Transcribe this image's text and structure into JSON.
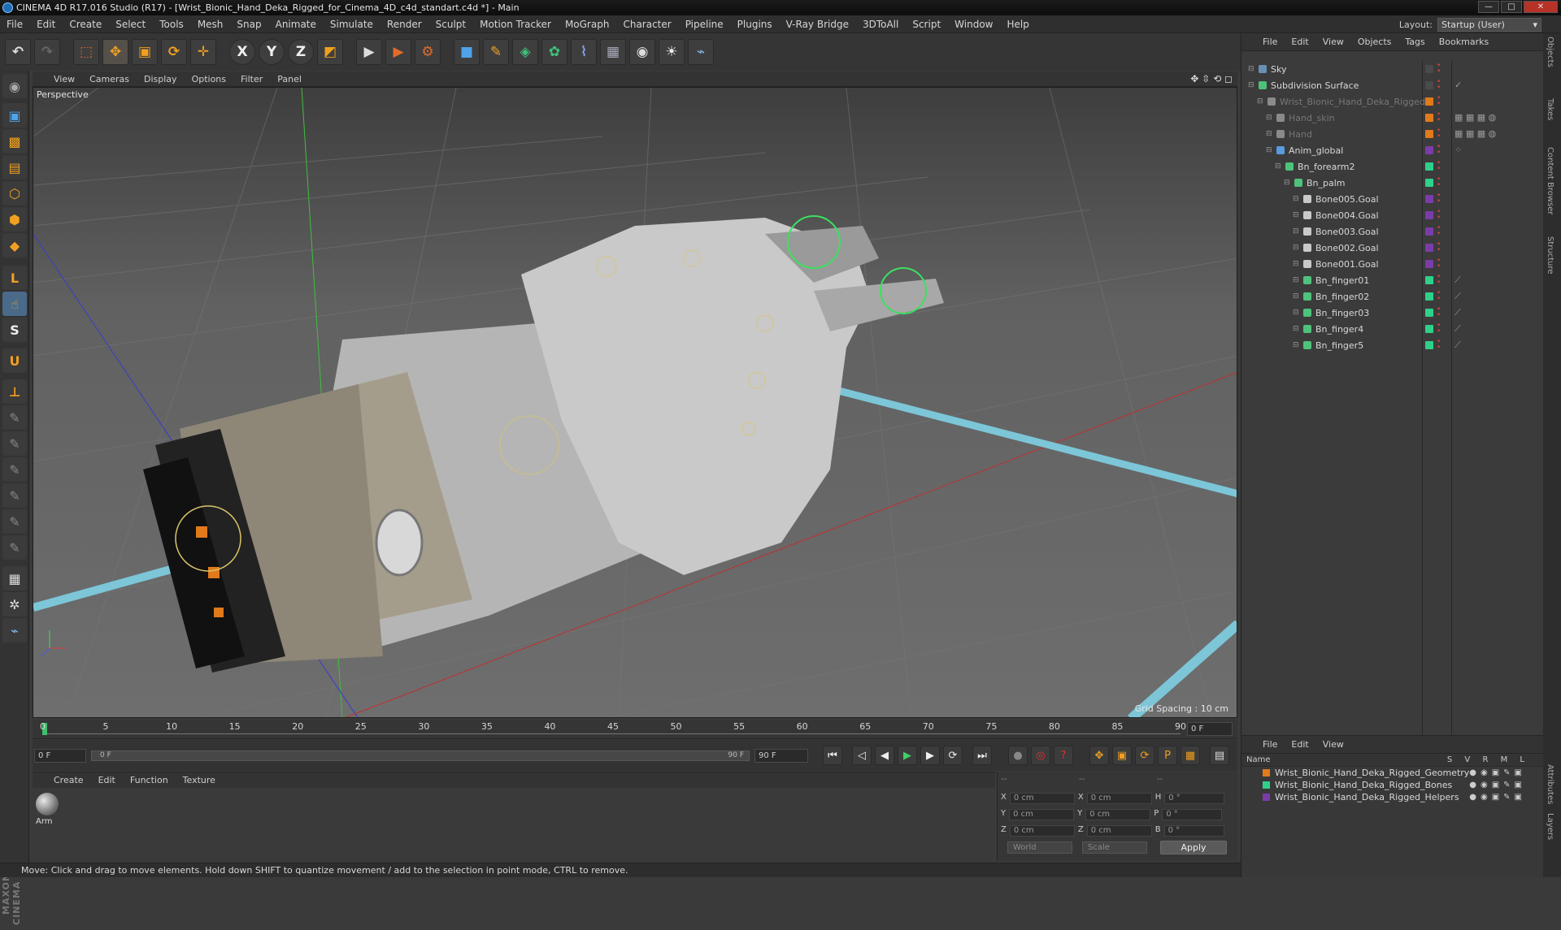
{
  "window": {
    "title": "CINEMA 4D R17.016 Studio (R17) - [Wrist_Bionic_Hand_Deka_Rigged_for_Cinema_4D_c4d_standart.c4d *] - Main",
    "minimize": "—",
    "maximize": "□",
    "close": "✕"
  },
  "menubar": [
    "File",
    "Edit",
    "Create",
    "Select",
    "Tools",
    "Mesh",
    "Snap",
    "Animate",
    "Simulate",
    "Render",
    "Sculpt",
    "Motion Tracker",
    "MoGraph",
    "Character",
    "Pipeline",
    "Plugins",
    "V-Ray Bridge",
    "3DToAll",
    "Script",
    "Window",
    "Help"
  ],
  "layout": {
    "label": "Layout:",
    "value": "Startup (User)"
  },
  "toolbar": {
    "undo": "↶",
    "redo": "↷",
    "select": "⬚",
    "move": "✥",
    "scale": "▣",
    "rotate": "⟳",
    "create": "✛",
    "x": "X",
    "y": "Y",
    "z": "Z",
    "coord": "◩",
    "render_view": "▶",
    "render": "▶",
    "render_settings": "⚙",
    "cube": "■",
    "pen": "✎",
    "subdiv": "◈",
    "cloner": "✿",
    "deformer": "⌇",
    "floor": "▦",
    "camera": "◉",
    "light": "☀",
    "python": "⌁"
  },
  "viewport": {
    "menu": [
      "View",
      "Cameras",
      "Display",
      "Options",
      "Filter",
      "Panel"
    ],
    "label": "Perspective",
    "grid_spacing": "Grid Spacing : 10 cm",
    "controls": "✥ ⇳ ⟲ ◻"
  },
  "timeline": {
    "ticks": [
      "0",
      "5",
      "10",
      "15",
      "20",
      "25",
      "30",
      "35",
      "40",
      "45",
      "50",
      "55",
      "60",
      "65",
      "70",
      "75",
      "80",
      "85",
      "90"
    ],
    "current_frame": "0 F"
  },
  "transport": {
    "start": "0 F",
    "slider_start": "0 F",
    "slider_end": "90 F",
    "end": "90 F",
    "buttons": {
      "first": "⏮",
      "prev_key": "◁",
      "prev": "◀",
      "play": "▶",
      "next": "▶",
      "loop": "⟳",
      "last": "⏭",
      "rec": "●",
      "autokey": "◎",
      "help": "?"
    }
  },
  "materials": {
    "menu": [
      "Create",
      "Edit",
      "Function",
      "Texture"
    ],
    "items": [
      {
        "name": "Arm"
      }
    ]
  },
  "coordinates": {
    "header_left": "--",
    "header_mid": "--",
    "header_right": "--",
    "rows": [
      {
        "a": "X",
        "av": "0 cm",
        "b": "X",
        "bv": "0 cm",
        "c": "H",
        "cv": "0 °"
      },
      {
        "a": "Y",
        "av": "0 cm",
        "b": "Y",
        "bv": "0 cm",
        "c": "P",
        "cv": "0 °"
      },
      {
        "a": "Z",
        "av": "0 cm",
        "b": "Z",
        "bv": "0 cm",
        "c": "B",
        "cv": "0 °"
      }
    ],
    "space": "World",
    "mode": "Scale",
    "apply": "Apply"
  },
  "status": "Move: Click and drag to move elements. Hold down SHIFT to quantize movement / add to the selection in point mode, CTRL to remove.",
  "object_manager": {
    "menu": [
      "File",
      "Edit",
      "View",
      "Objects",
      "Tags",
      "Bookmarks"
    ],
    "objects": [
      {
        "name": "Sky",
        "indent": 0,
        "color": "#6a8fb5",
        "flag": "#4a4a4a",
        "dim": false,
        "tags": ""
      },
      {
        "name": "Subdivision Surface",
        "indent": 0,
        "color": "#4ec27a",
        "flag": "#4a4a4a",
        "dim": false,
        "tags": "✓"
      },
      {
        "name": "Wrist_Bionic_Hand_Deka_Rigged",
        "indent": 1,
        "color": "#8a8a8a",
        "flag": "#e07a1a",
        "dim": true,
        "tags": ""
      },
      {
        "name": "Hand_skin",
        "indent": 2,
        "color": "#8a8a8a",
        "flag": "#e07a1a",
        "dim": true,
        "tags": "▦ ▦ ▦ ◍"
      },
      {
        "name": "Hand",
        "indent": 2,
        "color": "#8a8a8a",
        "flag": "#e07a1a",
        "dim": true,
        "tags": "▦ ▦ ▦ ◍"
      },
      {
        "name": "Anim_global",
        "indent": 2,
        "color": "#5a9ae0",
        "flag": "#7a3ca8",
        "dim": false,
        "tags": "⁘"
      },
      {
        "name": "Bn_forearm2",
        "indent": 3,
        "color": "#4ec27a",
        "flag": "#2fd08a",
        "dim": false,
        "tags": ""
      },
      {
        "name": "Bn_palm",
        "indent": 4,
        "color": "#4ec27a",
        "flag": "#2fd08a",
        "dim": false,
        "tags": ""
      },
      {
        "name": "Bone005.Goal",
        "indent": 5,
        "color": "#c9c9c9",
        "flag": "#7a3ca8",
        "dim": false,
        "tags": ""
      },
      {
        "name": "Bone004.Goal",
        "indent": 5,
        "color": "#c9c9c9",
        "flag": "#7a3ca8",
        "dim": false,
        "tags": ""
      },
      {
        "name": "Bone003.Goal",
        "indent": 5,
        "color": "#c9c9c9",
        "flag": "#7a3ca8",
        "dim": false,
        "tags": ""
      },
      {
        "name": "Bone002.Goal",
        "indent": 5,
        "color": "#c9c9c9",
        "flag": "#7a3ca8",
        "dim": false,
        "tags": ""
      },
      {
        "name": "Bone001.Goal",
        "indent": 5,
        "color": "#c9c9c9",
        "flag": "#7a3ca8",
        "dim": false,
        "tags": ""
      },
      {
        "name": "Bn_finger01",
        "indent": 5,
        "color": "#4ec27a",
        "flag": "#2fd08a",
        "dim": false,
        "tags": "⟋"
      },
      {
        "name": "Bn_finger02",
        "indent": 5,
        "color": "#4ec27a",
        "flag": "#2fd08a",
        "dim": false,
        "tags": "⟋"
      },
      {
        "name": "Bn_finger03",
        "indent": 5,
        "color": "#4ec27a",
        "flag": "#2fd08a",
        "dim": false,
        "tags": "⟋"
      },
      {
        "name": "Bn_finger4",
        "indent": 5,
        "color": "#4ec27a",
        "flag": "#2fd08a",
        "dim": false,
        "tags": "⟋"
      },
      {
        "name": "Bn_finger5",
        "indent": 5,
        "color": "#4ec27a",
        "flag": "#2fd08a",
        "dim": false,
        "tags": "⟋"
      }
    ]
  },
  "layer_manager": {
    "menu": [
      "File",
      "Edit",
      "View"
    ],
    "columns": {
      "name": "Name",
      "s": "S",
      "v": "V",
      "r": "R",
      "m": "M",
      "l": "L"
    },
    "layers": [
      {
        "name": "Wrist_Bionic_Hand_Deka_Rigged_Geometry",
        "color": "#e07a1a"
      },
      {
        "name": "Wrist_Bionic_Hand_Deka_Rigged_Bones",
        "color": "#2fd08a"
      },
      {
        "name": "Wrist_Bionic_Hand_Deka_Rigged_Helpers",
        "color": "#7a3ca8"
      }
    ]
  },
  "side_tabs": [
    "Objects",
    "Takes",
    "Content Browser",
    "Structure",
    "Attributes",
    "Layers"
  ]
}
